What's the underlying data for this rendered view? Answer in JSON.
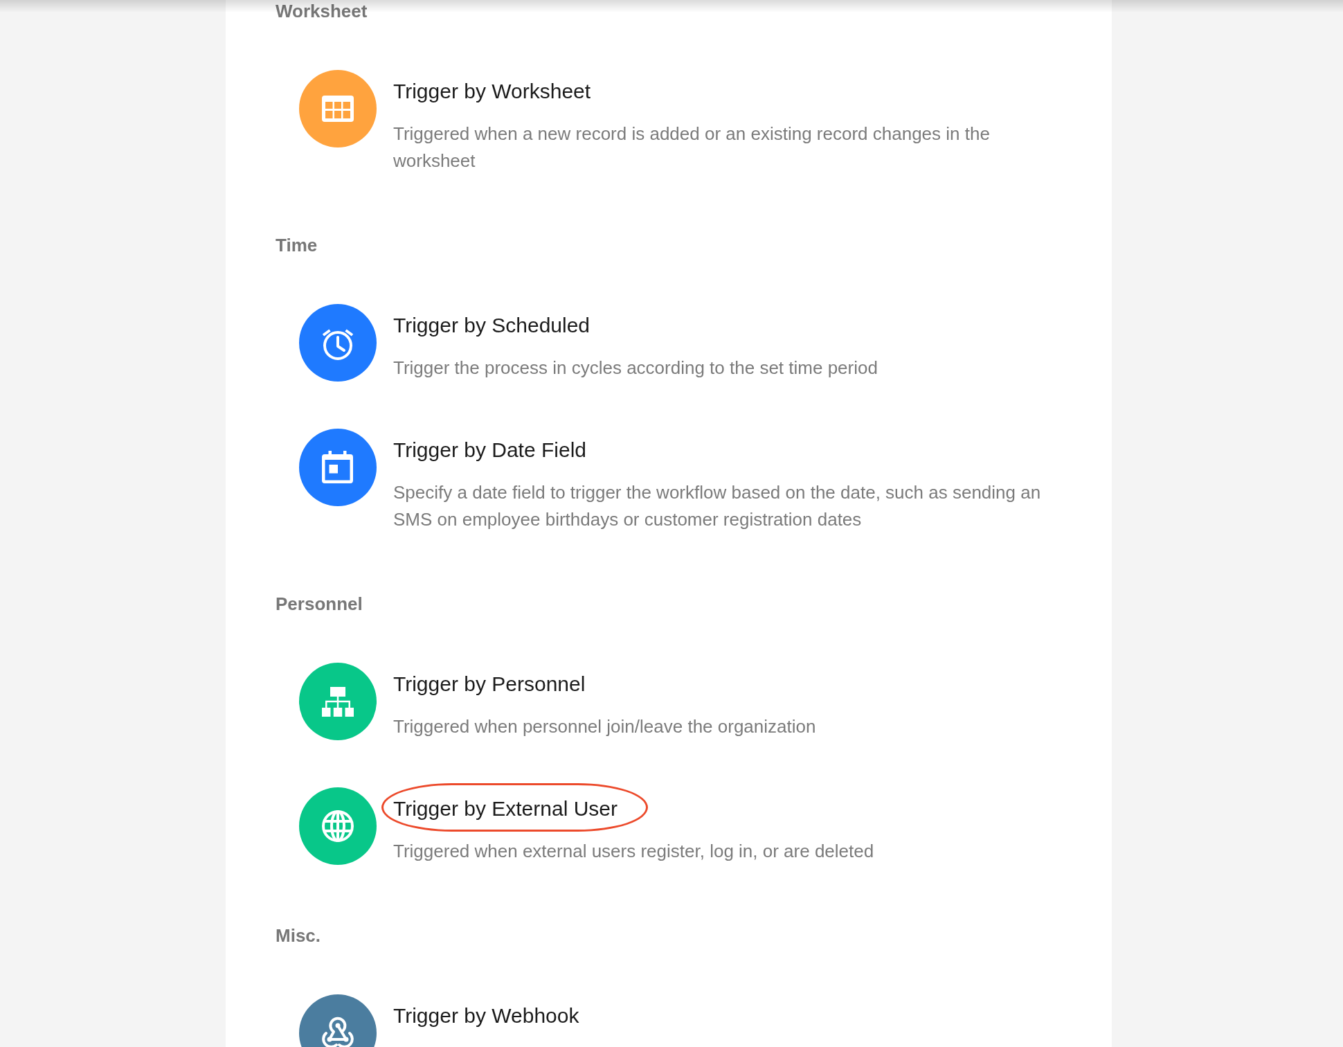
{
  "sections": [
    {
      "heading": "Worksheet",
      "items": [
        {
          "kind": "worksheet",
          "color": "#ffa33e",
          "title": "Trigger by Worksheet",
          "description": "Triggered when a new record is added or an existing record changes in the worksheet",
          "highlighted": false
        }
      ]
    },
    {
      "heading": "Time",
      "items": [
        {
          "kind": "scheduled",
          "color": "#1f7aff",
          "title": "Trigger by Scheduled",
          "description": "Trigger the process in cycles according to the set time period",
          "highlighted": false
        },
        {
          "kind": "date",
          "color": "#1f7aff",
          "title": "Trigger by Date Field",
          "description": "Specify a date field to trigger the workflow based on the date, such as sending an SMS on employee birthdays or customer registration dates",
          "highlighted": false
        }
      ]
    },
    {
      "heading": "Personnel",
      "items": [
        {
          "kind": "personnel",
          "color": "#08c789",
          "title": "Trigger by Personnel",
          "description": "Triggered when personnel join/leave the organization",
          "highlighted": false
        },
        {
          "kind": "external",
          "color": "#08c789",
          "title": "Trigger by External User",
          "description": "Triggered when external users register, log in, or are deleted",
          "highlighted": true
        }
      ]
    },
    {
      "heading": "Misc.",
      "items": [
        {
          "kind": "webhook",
          "color": "#4b7d9f",
          "title": "Trigger by Webhook",
          "highlighted": false
        }
      ]
    }
  ]
}
